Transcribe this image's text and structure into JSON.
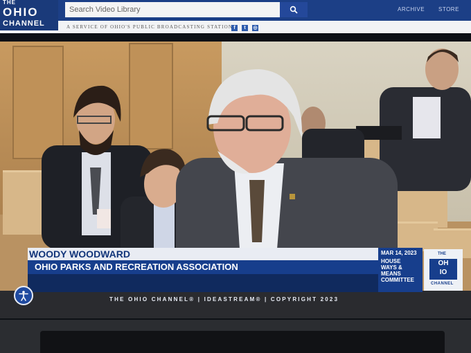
{
  "header": {
    "logo": {
      "the": "THE",
      "ohio": "OHIO",
      "channel": "CHANNEL"
    },
    "search": {
      "placeholder": "Search Video Library"
    },
    "nav": {
      "archive": "ARCHIVE",
      "store": "STORE"
    },
    "tagline": "A SERVICE OF OHIO'S PUBLIC BROADCASTING STATIONS",
    "social": [
      {
        "icon": "facebook-icon",
        "glyph": "f"
      },
      {
        "icon": "twitter-icon",
        "glyph": "t"
      },
      {
        "icon": "instagram-icon",
        "glyph": "◎"
      }
    ]
  },
  "lower_third": {
    "name": "WOODY WOODWARD",
    "organization": "OHIO PARKS AND RECREATION ASSOCIATION",
    "date": "MAR 14, 2023",
    "committee_lines": [
      "HOUSE",
      "WAYS &",
      "MEANS",
      "COMMITTEE"
    ],
    "logo": {
      "the": "THE",
      "ohio_left": "OH",
      "ohio_right": "IO",
      "channel": "CHANNEL"
    },
    "footer": "THE OHIO CHANNEL® | IDEASTREAM® | COPYRIGHT 2023"
  },
  "colors": {
    "brand_blue": "#173e8c",
    "header_blue": "#1c3f86",
    "name_bar": "#e9ecf3"
  }
}
